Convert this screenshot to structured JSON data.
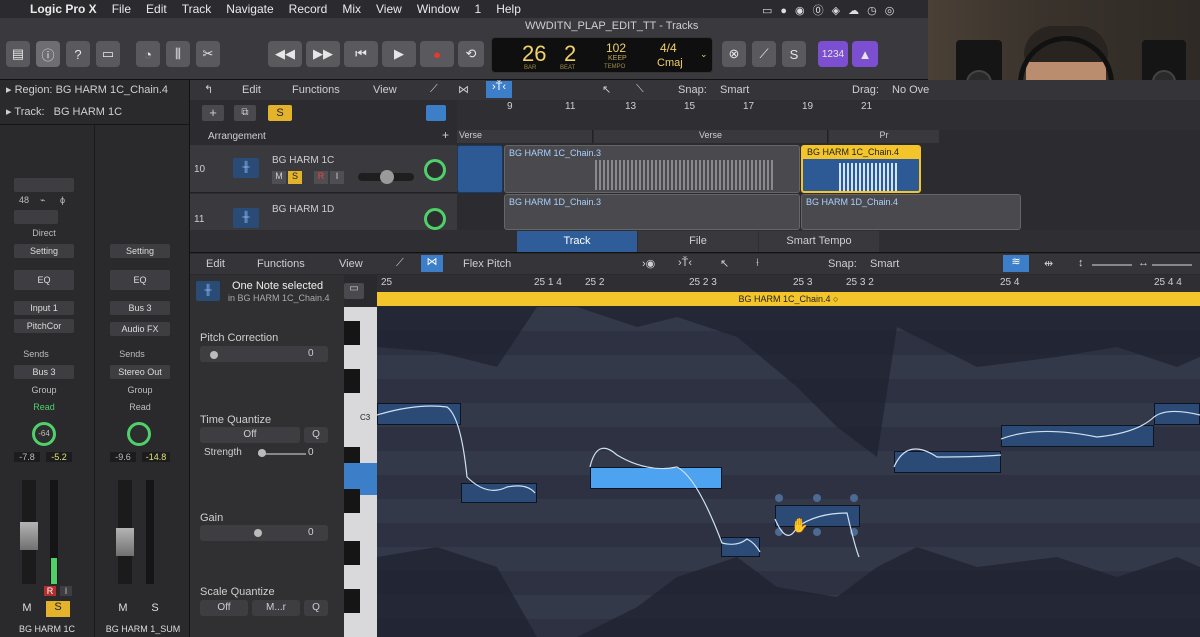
{
  "menubar": {
    "app": "Logic Pro X",
    "items": [
      "File",
      "Edit",
      "Track",
      "Navigate",
      "Record",
      "Mix",
      "View",
      "Window",
      "1",
      "Help"
    ]
  },
  "window": {
    "title": "WWDITN_PLAP_EDIT_TT - Tracks"
  },
  "lcd": {
    "bar": "26",
    "beat": "2",
    "bar_label": "BAR",
    "beat_label": "BEAT",
    "tempo": "102",
    "keep": "KEEP",
    "tempo_label": "TEMPO",
    "sig": "4/4",
    "key": "Cmaj"
  },
  "toolbar": {
    "count_label": "1234"
  },
  "inspector": {
    "region_label": "Region:",
    "region_name": "BG HARM 1C_Chain.4",
    "track_label": "Track:",
    "track_name": "BG HARM 1C",
    "strip1": {
      "direct": "Direct",
      "setting": "Setting",
      "eq": "EQ",
      "input": "Input 1",
      "plugin": "PitchCor",
      "sends": "Sends",
      "bus": "Bus 3",
      "group": "Group",
      "auto": "Read",
      "pan": "-64",
      "val1": "-7.8",
      "val2": "-5.2",
      "m": "M",
      "s": "S",
      "r": "R",
      "i": "I",
      "name": "BG HARM 1C",
      "field1": "48"
    },
    "strip2": {
      "setting": "Setting",
      "eq": "EQ",
      "input": "Bus 3",
      "plugin": "Audio FX",
      "sends": "Sends",
      "bus": "Stereo Out",
      "group": "Group",
      "auto": "Read",
      "val1": "-9.6",
      "val2": "-14.8",
      "m": "M",
      "s": "S",
      "name": "BG HARM 1_SUM"
    }
  },
  "tracks_header": {
    "edit": "Edit",
    "functions": "Functions",
    "view": "View",
    "snap_label": "Snap:",
    "snap": "Smart",
    "drag_label": "Drag:",
    "drag": "No Ove",
    "arrangement": "Arrangement"
  },
  "ruler": {
    "marks": [
      "9",
      "11",
      "13",
      "15",
      "17",
      "19",
      "21"
    ]
  },
  "arrangement_markers": [
    "Verse",
    "Verse",
    "Pr"
  ],
  "tracks": [
    {
      "num": "10",
      "name": "BG HARM 1C",
      "m": "M",
      "s": "S",
      "r": "R",
      "i": "I"
    },
    {
      "num": "11",
      "name": "BG HARM 1D"
    }
  ],
  "regions": [
    "BG HARM 1C_Chain.3",
    "BG HARM 1C_Chain.4",
    "BG HARM 1D_Chain.3",
    "BG HARM 1D_Chain.4"
  ],
  "editor": {
    "tabs": [
      "Track",
      "File",
      "Smart Tempo"
    ],
    "edit": "Edit",
    "functions": "Functions",
    "view": "View",
    "mode": "Flex Pitch",
    "snap_label": "Snap:",
    "snap": "Smart",
    "selection_title": "One Note selected",
    "selection_sub": "in BG HARM 1C_Chain.4",
    "pitch_correction_label": "Pitch Correction",
    "pitch_correction_val": "0",
    "time_quantize_label": "Time Quantize",
    "time_quantize_val": "Off",
    "q": "Q",
    "strength_label": "Strength",
    "strength_val": "0",
    "gain_label": "Gain",
    "gain_val": "0",
    "scale_quantize_label": "Scale Quantize",
    "scale_off": "Off",
    "scale_mode": "M...r",
    "scale_q": "Q",
    "ruler": [
      "25",
      "25 1 4",
      "25 2",
      "25 2 3",
      "25 3",
      "25 3 2",
      "25 4",
      "25 4 4"
    ],
    "region_name": "BG HARM 1C_Chain.4",
    "key_label": "C3"
  },
  "colors": {
    "accent": "#3d7ec9",
    "region_yellow": "#f3c52a",
    "region_blue": "#2d5a94",
    "note_selected": "#4ea3f0",
    "meter_green": "#4fd06a"
  }
}
